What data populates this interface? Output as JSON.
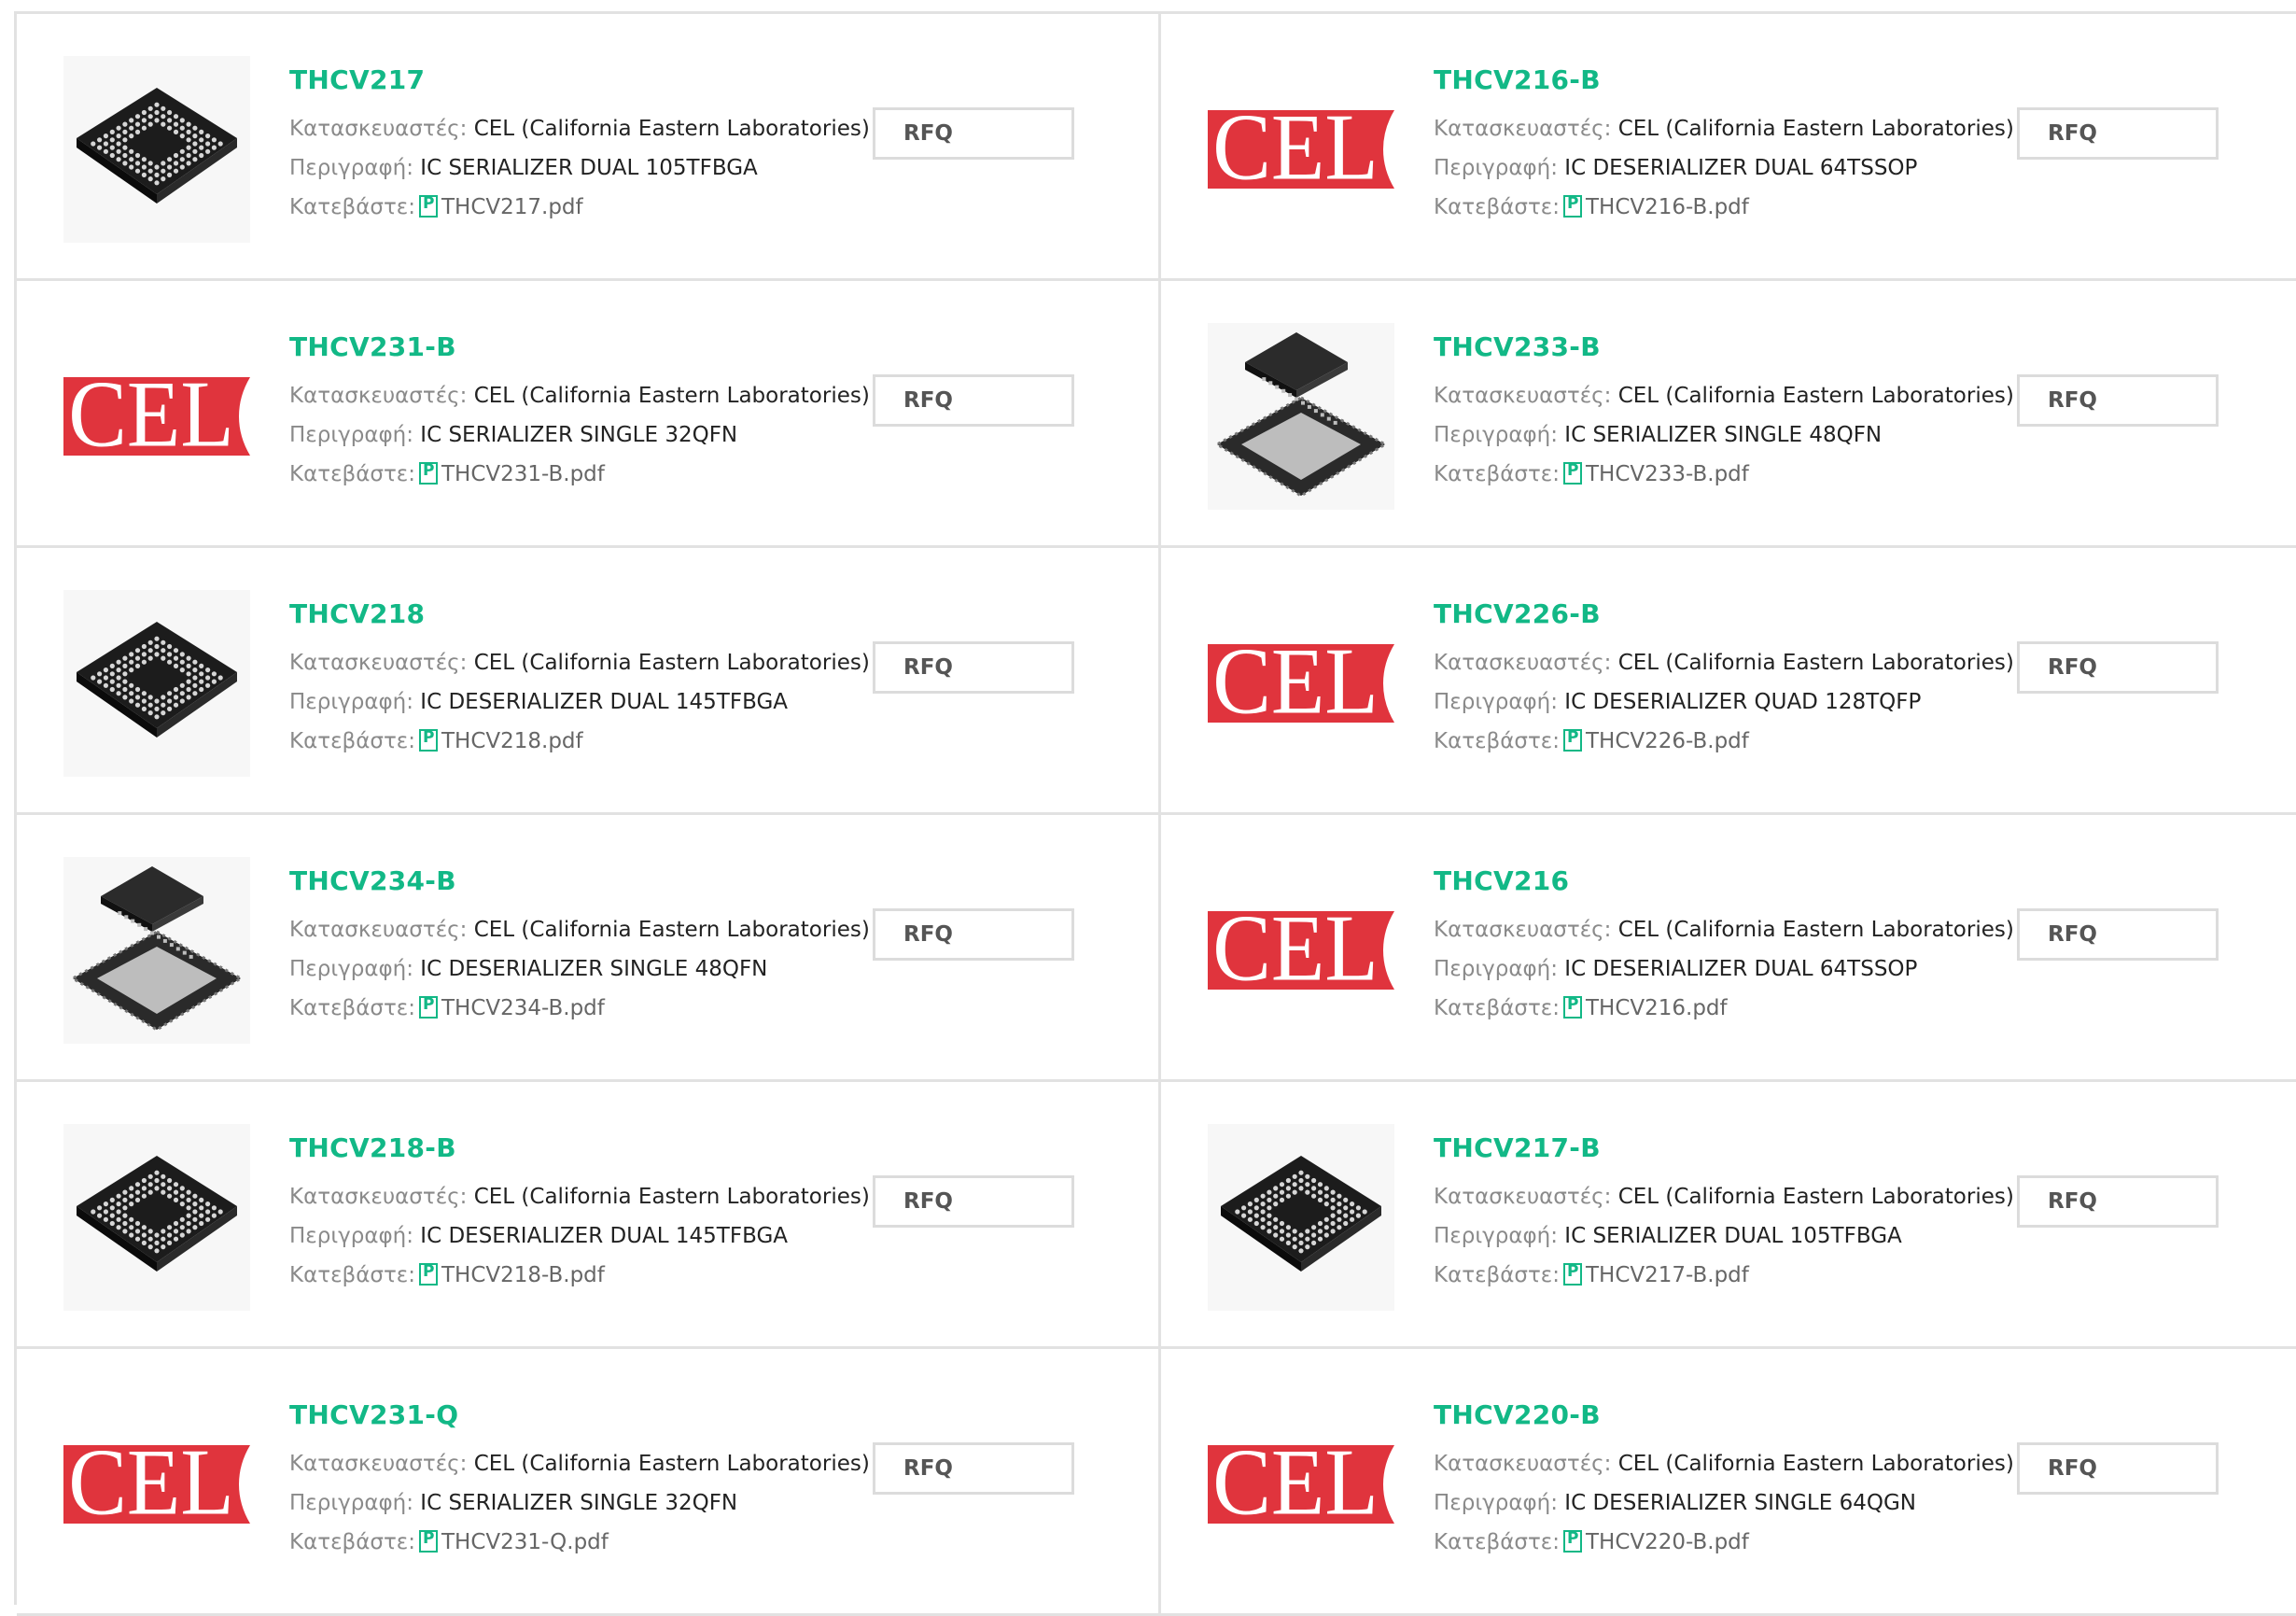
{
  "labels": {
    "manufacturer": "Κατασκευαστές:",
    "description": "Περιγραφή:",
    "download": "Κατεβάστε:",
    "rfq": "RFQ",
    "logo_text": "CEL"
  },
  "colors": {
    "part_link": "#12b886",
    "logo_red": "#e0343d",
    "border": "#e2e2e2"
  },
  "products": [
    {
      "name": "THCV217",
      "manufacturer": "CEL (California Eastern Laboratories)",
      "description": "IC SERIALIZER DUAL 105TFBGA",
      "pdf": "THCV217.pdf",
      "image": "bga-chip-icon"
    },
    {
      "name": "THCV216-B",
      "manufacturer": "CEL (California Eastern Laboratories)",
      "description": "IC DESERIALIZER DUAL 64TSSOP",
      "pdf": "THCV216-B.pdf",
      "image": "cel-logo"
    },
    {
      "name": "THCV231-B",
      "manufacturer": "CEL (California Eastern Laboratories)",
      "description": "IC SERIALIZER SINGLE 32QFN",
      "pdf": "THCV231-B.pdf",
      "image": "cel-logo"
    },
    {
      "name": "THCV233-B",
      "manufacturer": "CEL (California Eastern Laboratories)",
      "description": "IC SERIALIZER SINGLE 48QFN",
      "pdf": "THCV233-B.pdf",
      "image": "qfn-chip-icon"
    },
    {
      "name": "THCV218",
      "manufacturer": "CEL (California Eastern Laboratories)",
      "description": "IC DESERIALIZER DUAL 145TFBGA",
      "pdf": "THCV218.pdf",
      "image": "bga-chip-icon"
    },
    {
      "name": "THCV226-B",
      "manufacturer": "CEL (California Eastern Laboratories)",
      "description": "IC DESERIALIZER QUAD 128TQFP",
      "pdf": "THCV226-B.pdf",
      "image": "cel-logo"
    },
    {
      "name": "THCV234-B",
      "manufacturer": "CEL (California Eastern Laboratories)",
      "description": "IC DESERIALIZER SINGLE 48QFN",
      "pdf": "THCV234-B.pdf",
      "image": "qfn-chip-icon"
    },
    {
      "name": "THCV216",
      "manufacturer": "CEL (California Eastern Laboratories)",
      "description": "IC DESERIALIZER DUAL 64TSSOP",
      "pdf": "THCV216.pdf",
      "image": "cel-logo"
    },
    {
      "name": "THCV218-B",
      "manufacturer": "CEL (California Eastern Laboratories)",
      "description": "IC DESERIALIZER DUAL 145TFBGA",
      "pdf": "THCV218-B.pdf",
      "image": "bga-chip-icon"
    },
    {
      "name": "THCV217-B",
      "manufacturer": "CEL (California Eastern Laboratories)",
      "description": "IC SERIALIZER DUAL 105TFBGA",
      "pdf": "THCV217-B.pdf",
      "image": "bga-chip-icon"
    },
    {
      "name": "THCV231-Q",
      "manufacturer": "CEL (California Eastern Laboratories)",
      "description": "IC SERIALIZER SINGLE 32QFN",
      "pdf": "THCV231-Q.pdf",
      "image": "cel-logo"
    },
    {
      "name": "THCV220-B",
      "manufacturer": "CEL (California Eastern Laboratories)",
      "description": "IC DESERIALIZER SINGLE 64QGN",
      "pdf": "THCV220-B.pdf",
      "image": "cel-logo"
    }
  ]
}
